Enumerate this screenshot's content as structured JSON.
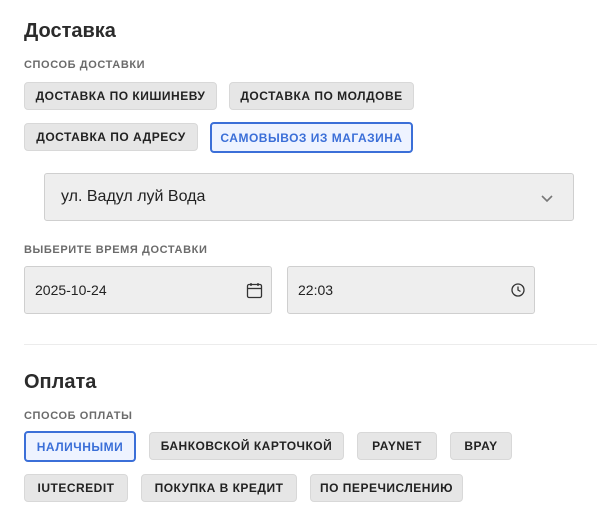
{
  "delivery": {
    "title": "Доставка",
    "method_label": "СПОСОБ ДОСТАВКИ",
    "options": [
      {
        "label": "ДОСТАВКА ПО КИШИНЕВУ",
        "selected": false
      },
      {
        "label": "ДОСТАВКА ПО МОЛДОВЕ",
        "selected": false
      },
      {
        "label": "ДОСТАВКА ПО АДРЕСУ",
        "selected": false
      },
      {
        "label": "САМОВЫВОЗ ИЗ МАГАЗИНА",
        "selected": true
      }
    ],
    "store_select_value": "ул. Вадул луй Вода",
    "time_label": "ВЫБЕРИТЕ ВРЕМЯ ДОСТАВКИ",
    "date_value": "2025-10-24",
    "time_value": "22:03"
  },
  "payment": {
    "title": "Оплата",
    "method_label": "СПОСОБ ОПЛАТЫ",
    "options": [
      {
        "label": "НАЛИЧНЫМИ",
        "selected": true
      },
      {
        "label": "БАНКОВСКОЙ КАРТОЧКОЙ",
        "selected": false
      },
      {
        "label": "PAYNET",
        "selected": false
      },
      {
        "label": "BPAY",
        "selected": false
      },
      {
        "label": "IUTECREDIT",
        "selected": false
      },
      {
        "label": "ПОКУПКА В КРЕДИТ",
        "selected": false
      },
      {
        "label": "ПО ПЕРЕЧИСЛЕНИЮ",
        "selected": false
      }
    ]
  },
  "colors": {
    "accent": "#3b6fd8",
    "chip_bg": "#e6e6e6",
    "field_bg": "#eeeeee"
  },
  "icons": {
    "select": "chevron-down-icon",
    "date": "calendar-icon",
    "time": "clock-icon"
  }
}
